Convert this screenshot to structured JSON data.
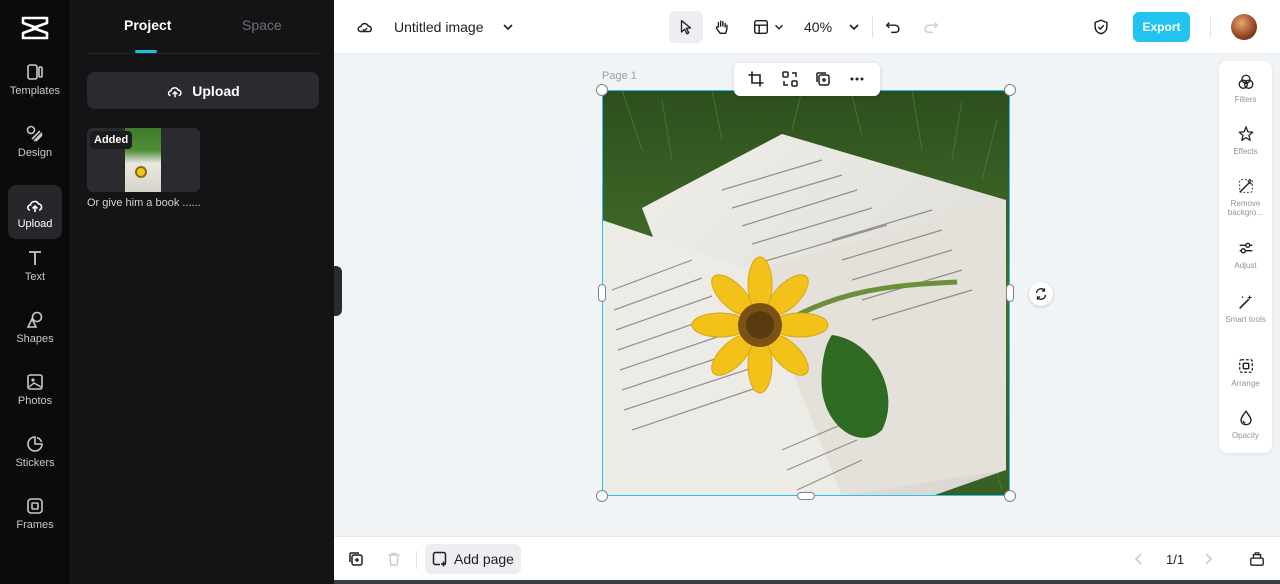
{
  "rail": {
    "items": [
      {
        "label": "Templates",
        "icon": "templates-icon"
      },
      {
        "label": "Design",
        "icon": "design-icon"
      },
      {
        "label": "Upload",
        "icon": "upload-cloud-icon",
        "active": true
      },
      {
        "label": "Text",
        "icon": "text-icon"
      },
      {
        "label": "Shapes",
        "icon": "shapes-icon"
      },
      {
        "label": "Photos",
        "icon": "photos-icon"
      },
      {
        "label": "Stickers",
        "icon": "stickers-icon"
      },
      {
        "label": "Frames",
        "icon": "frames-icon"
      }
    ]
  },
  "panel": {
    "tabs": [
      {
        "label": "Project",
        "active": true
      },
      {
        "label": "Space",
        "active": false
      }
    ],
    "upload_label": "Upload",
    "asset": {
      "badge": "Added",
      "caption": "Or give him a book ......"
    }
  },
  "topbar": {
    "title": "Untitled image",
    "zoom": "40%",
    "export_label": "Export"
  },
  "canvas": {
    "page_label": "Page 1"
  },
  "right_tools": [
    {
      "label": "Filters",
      "icon": "filters-icon"
    },
    {
      "label": "Effects",
      "icon": "effects-icon"
    },
    {
      "label": "Remove backgro...",
      "icon": "remove-background-icon"
    },
    {
      "label": "Adjust",
      "icon": "adjust-icon"
    },
    {
      "label": "Smart tools",
      "icon": "smart-tools-icon"
    },
    {
      "label": "Arrange",
      "icon": "arrange-icon"
    },
    {
      "label": "Opacity",
      "icon": "opacity-icon"
    }
  ],
  "bottombar": {
    "add_page_label": "Add page",
    "page_count": "1/1"
  },
  "colors": {
    "accent": "#22c3ee",
    "rail_bg": "#0b0b0c",
    "panel_bg": "#141416",
    "canvas_bg": "#f1f4f7"
  }
}
